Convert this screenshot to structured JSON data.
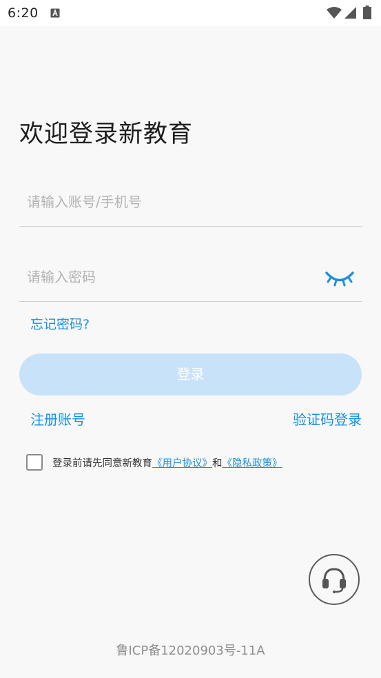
{
  "status_bar": {
    "time": "6:20",
    "app_icon": "a-notification-icon",
    "wifi_icon": "wifi-icon",
    "signal_icon": "cell-signal-icon",
    "battery_icon": "battery-icon"
  },
  "title": "欢迎登录新教育",
  "account_field": {
    "value": "",
    "placeholder": "请输入账号/手机号"
  },
  "password_field": {
    "value": "",
    "placeholder": "请输入密码",
    "toggle_icon": "eye-closed-icon"
  },
  "forgot_password": "忘记密码?",
  "login_button": "登录",
  "register": "注册账号",
  "sms_login": "验证码登录",
  "agreement": {
    "checked": false,
    "prefix": "登录前请先同意新教育",
    "user_agreement": "《用户协议》",
    "conjunction": "和",
    "privacy_policy": "《隐私政策》"
  },
  "support_icon": "headset-icon",
  "icp": "鲁ICP备12020903号-11A",
  "colors": {
    "accent": "#1c8fe0",
    "login_button_bg": "#c8e3f9",
    "background": "#f8f8f8"
  }
}
